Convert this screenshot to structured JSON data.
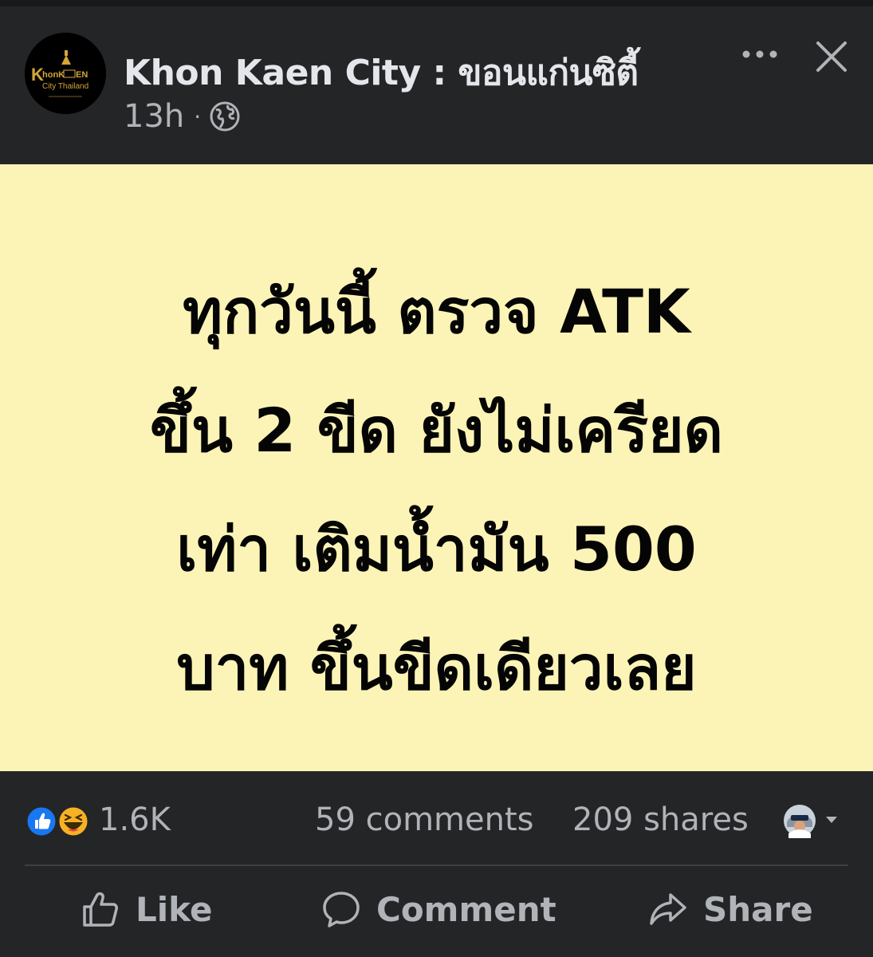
{
  "header": {
    "page_name": "Khon Kaen City : ขอนแก่นซิตี้",
    "timestamp": "13h",
    "separator": "·",
    "privacy_icon": "globe-icon",
    "more_icon": "more-horizontal-icon",
    "close_icon": "close-icon",
    "avatar": {
      "logo_text_line1": "KhonKAEN",
      "logo_text_line2": "City Thailand",
      "logo_color": "#d4a537"
    }
  },
  "post": {
    "background_color": "#fcf4b6",
    "text_color": "#050505",
    "lines": [
      "ทุกวันนี้ ตรวจ ATK",
      "ขึ้น 2 ขีด ยังไม่เครียด",
      "เท่า เติมน้ำมัน 500",
      "บาท ขึ้นขีดเดียวเลย"
    ]
  },
  "stats": {
    "reaction_icons": [
      "like-reaction-icon",
      "haha-reaction-icon"
    ],
    "reaction_count": "1.6K",
    "comments": "59 comments",
    "shares": "209 shares",
    "viewer_icon": "viewer-avatar-icon",
    "dropdown_icon": "caret-down-icon"
  },
  "actions": {
    "like": {
      "label": "Like",
      "icon": "thumbs-up-icon"
    },
    "comment": {
      "label": "Comment",
      "icon": "comment-bubble-icon"
    },
    "share": {
      "label": "Share",
      "icon": "share-arrow-icon"
    }
  },
  "colors": {
    "background": "#242526",
    "primary_text": "#e4e6eb",
    "secondary_text": "#b0b3b8",
    "like_blue": "#1877f2",
    "haha_yellow": "#f7b125"
  }
}
